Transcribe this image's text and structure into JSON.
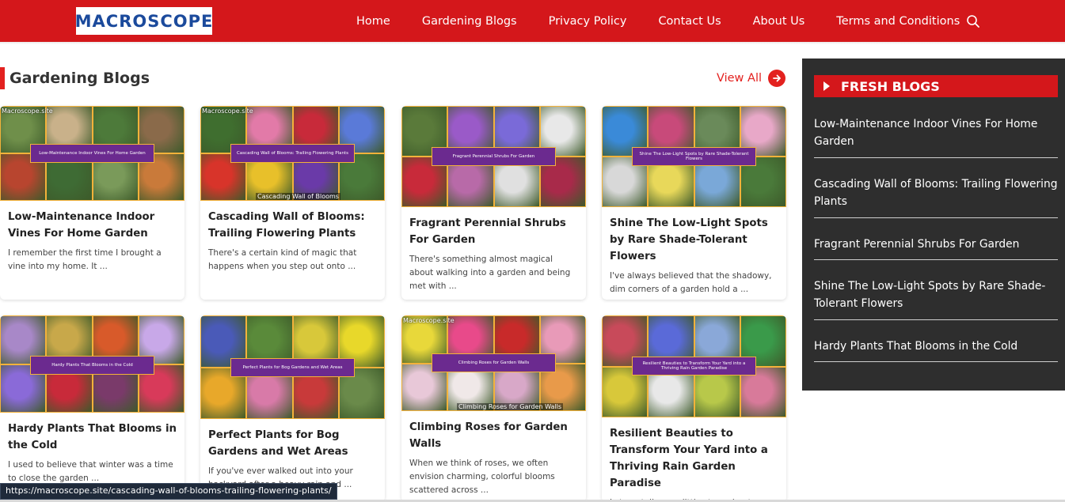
{
  "header": {
    "logo_text": "MACROSCOPE",
    "nav": [
      "Home",
      "Gardening Blogs",
      "Privacy Policy",
      "Contact Us",
      "About Us",
      "Terms and Conditions"
    ],
    "search_icon": "search-icon"
  },
  "section": {
    "title": "Gardening Blogs",
    "view_all": "View All"
  },
  "cards": [
    {
      "title": "Low-Maintenance Indoor Vines For Home Garden",
      "excerpt": "I remember the first time I brought a vine into my home. It ...",
      "banner": "Low-Maintenance Indoor Vines For Home Garden",
      "watermark": "Macroscope.site",
      "caption": "",
      "colors": [
        "#6f8f4a",
        "#c9b18a",
        "#4d7a3a",
        "#8a6a4a",
        "#b8452f",
        "#3e6b34",
        "#7a9a5a",
        "#c97a3a"
      ]
    },
    {
      "title": "Cascading Wall of Blooms: Trailing Flowering Plants",
      "excerpt": "There's a certain kind of magic that happens when you step out onto ...",
      "banner": "Cascading Wall of Blooms: Trailing Flowering Plants",
      "watermark": "Macroscope.site",
      "caption": "Cascading Wall of Blooms",
      "colors": [
        "#3f6e2f",
        "#e27aa8",
        "#c82a3a",
        "#5a7ad8",
        "#d8342a",
        "#e8c02a",
        "#6a3aa8",
        "#4a7a3a"
      ]
    },
    {
      "title": "Fragrant Perennial Shrubs For Garden",
      "excerpt": "There's something almost magical about walking into a garden and being met with ...",
      "banner": "Fragrant Perennial Shrubs For Garden",
      "watermark": "",
      "caption": "",
      "colors": [
        "#5a7a3a",
        "#9a5ac8",
        "#7a6ad8",
        "#e8e8e8",
        "#c82a3a",
        "#b86aa8",
        "#e0e0e0",
        "#a82a4a"
      ]
    },
    {
      "title": "Shine The Low-Light Spots by Rare Shade-Tolerant Flowers",
      "excerpt": "I've always believed that the shadowy, dim corners of a garden hold a ...",
      "banner": "Shine The Low-Light Spots by Rare Shade-Tolerant Flowers",
      "watermark": "",
      "caption": "",
      "colors": [
        "#3a8ad8",
        "#c84a7a",
        "#6a8a5a",
        "#e8a8c8",
        "#d8d8d8",
        "#e8d85a",
        "#7aa8d8",
        "#4a7a3a"
      ]
    },
    {
      "title": "Hardy Plants That Blooms in the Cold",
      "excerpt": "I used to believe that winter was a time to close the garden ...",
      "banner": "Hardy Plants That Blooms in the Cold",
      "watermark": "",
      "caption": "",
      "colors": [
        "#a888c8",
        "#c8a84a",
        "#d85a2a",
        "#c8a8e8",
        "#8a6ad8",
        "#c82a3a",
        "#7a3a6a",
        "#d83a5a"
      ]
    },
    {
      "title": "Perfect Plants for Bog Gardens and Wet Areas",
      "excerpt": "If you've ever walked out into your backyard after a heavy rain and ...",
      "banner": "Perfect Plants for Bog Gardens and Wet Areas",
      "watermark": "",
      "caption": "",
      "colors": [
        "#4a5ab8",
        "#5a8a3a",
        "#d8c83a",
        "#e8d82a",
        "#e8a82a",
        "#d87aa8",
        "#c83a3a",
        "#6a8a4a"
      ]
    },
    {
      "title": "Climbing Roses for Garden Walls",
      "excerpt": "When we think of roses, we often envision charming, colorful blooms scattered across ...",
      "banner": "Climbing Roses for Garden Walls",
      "watermark": "Macroscope.site",
      "caption": "Climbing Roses for Garden Walls",
      "colors": [
        "#e8d83a",
        "#e84a8a",
        "#c82a2a",
        "#e89ab8",
        "#e8c8d8",
        "#f0e8e8",
        "#d8a8c8",
        "#e89a4a"
      ]
    },
    {
      "title": "Resilient Beauties to Transform Your Yard into a Thriving Rain Garden Paradise",
      "excerpt": "Let me tell you a little story about my backyard and how a ...",
      "banner": "Resilient Beauties to Transform Your Yard into a Thriving Rain Garden Paradise",
      "watermark": "",
      "caption": "",
      "colors": [
        "#c84a5a",
        "#5a6ad8",
        "#8aa8d8",
        "#3a9a4a",
        "#d8c83a",
        "#e8e8e8",
        "#b8c84a",
        "#d87a9a"
      ]
    }
  ],
  "sidebar": {
    "heading": "FRESH BLOGS",
    "items": [
      "Low-Maintenance Indoor Vines For Home Garden",
      "Cascading Wall of Blooms: Trailing Flowering Plants",
      "Fragrant Perennial Shrubs For Garden",
      "Shine The Low-Light Spots by Rare Shade-Tolerant Flowers",
      "Hardy Plants That Blooms in the Cold"
    ]
  },
  "status_url": "https://macroscope.site/cascading-wall-of-blooms-trailing-flowering-plants/"
}
